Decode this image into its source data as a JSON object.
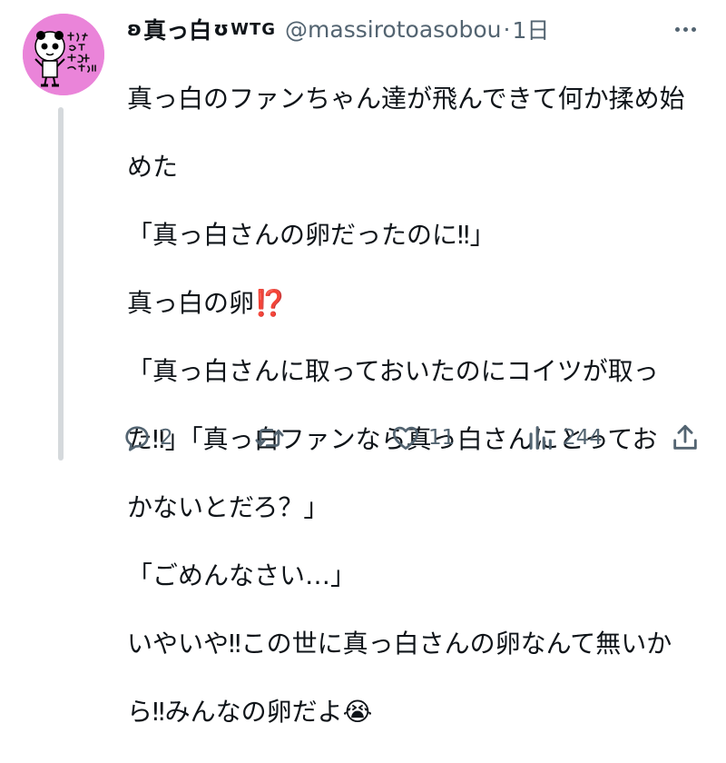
{
  "author": {
    "name": "真っ白",
    "prefix_emblem": "ʚ",
    "suffix_emblem": "ʊ",
    "tag": "WTG",
    "handle": "@massirotoasobou",
    "separator": "·",
    "time": "1日"
  },
  "avatar": {
    "background": "#ea84d9",
    "art_text": "真っ白さんはげんきにおげてる"
  },
  "tweet": {
    "lines": [
      "真っ白のファンちゃん達が飛んできて何か揉め始",
      "めた",
      "「真っ白さんの卵だったのに‼」",
      "真っ白の卵⁉️",
      "「真っ白さんに取っておいたのにコイツが取っ",
      "た‼」「真っ白ファンなら真っ白さんにとってお",
      "かないとだろ？」",
      "「ごめんなさい…」",
      "いやいや‼この世に真っ白さんの卵なんて無いか",
      "ら‼みんなの卵だよ😭"
    ]
  },
  "actions": {
    "reply_count": "2",
    "retweet_count": "",
    "like_count": "11",
    "views_count": "244"
  },
  "icons": {
    "reply": "reply-icon",
    "retweet": "retweet-icon",
    "like": "heart-icon",
    "views": "views-icon",
    "share": "share-icon",
    "more": "more-icon"
  },
  "colors": {
    "text": "#0f1419",
    "secondary": "#536471",
    "thread_line": "#d5d9dc",
    "avatar_bg": "#ea84d9"
  }
}
